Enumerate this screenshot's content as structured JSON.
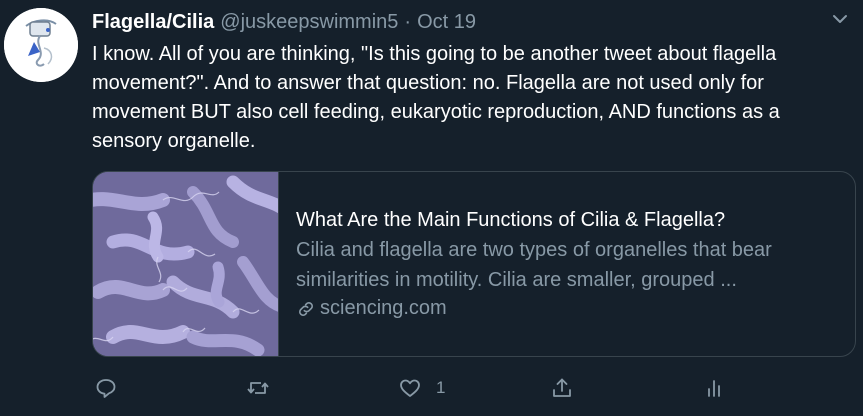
{
  "tweet": {
    "display_name": "Flagella/Cilia",
    "handle": "@juskeepswimmin5",
    "separator": "·",
    "date": "Oct 19",
    "text": "I know. All of you are thinking, \"Is this going to be another tweet about flagella movement?\". And to answer that question: no. Flagella are not used only for movement BUT also cell feeding, eukaryotic reproduction, AND functions as a sensory organelle."
  },
  "card": {
    "title": "What Are the Main Functions of Cilia & Flagella?",
    "description": "Cilia and flagella are two types of organelles that bear similarities in motility. Cilia are smaller, grouped ...",
    "domain": "sciencing.com",
    "domain_icon": "link-icon",
    "image": "bacteria-with-flagella-image"
  },
  "actions": {
    "reply_icon": "reply-icon",
    "retweet_icon": "retweet-icon",
    "like_icon": "heart-icon",
    "like_count": "1",
    "share_icon": "share-icon",
    "analytics_icon": "analytics-icon"
  },
  "colors": {
    "background": "#15202b",
    "text_primary": "#ffffff",
    "text_secondary": "#8899a6",
    "border": "#38444d",
    "image_tint": "#7a75a8"
  }
}
